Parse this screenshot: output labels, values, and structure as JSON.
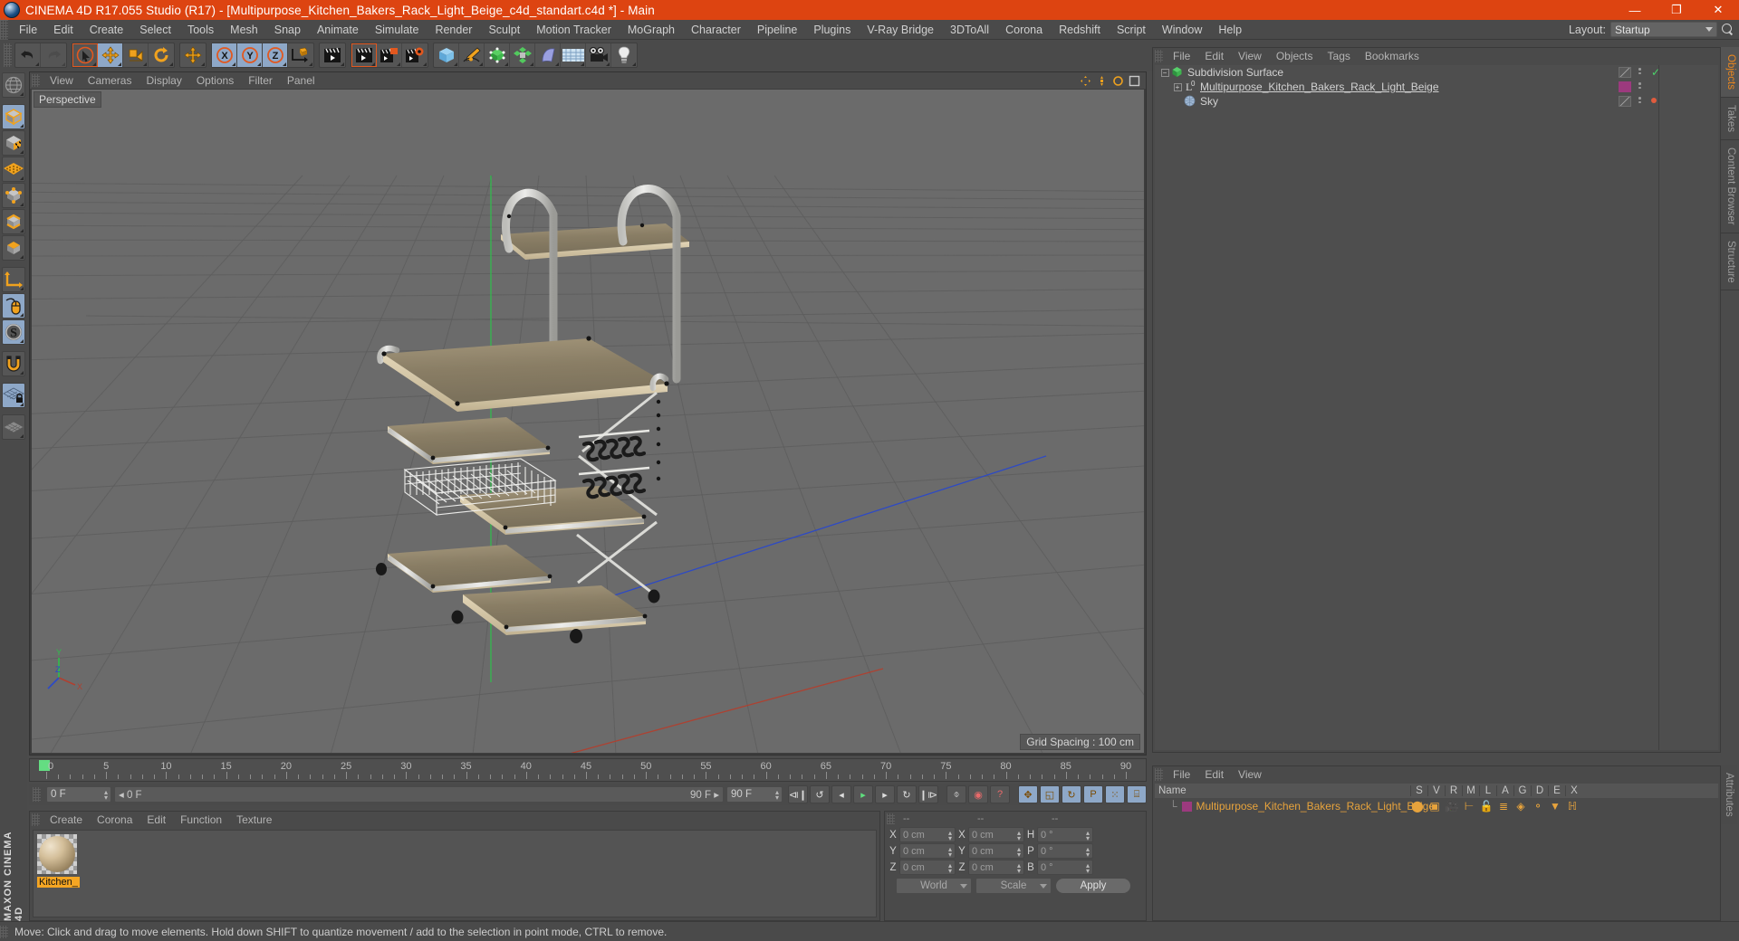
{
  "window": {
    "title": "CINEMA 4D R17.055 Studio (R17) - [Multipurpose_Kitchen_Bakers_Rack_Light_Beige_c4d_standart.c4d *] - Main",
    "minimize": "—",
    "maximize": "❐",
    "close": "✕",
    "accent": "#dd4411"
  },
  "menubar": {
    "items": [
      "File",
      "Edit",
      "Create",
      "Select",
      "Tools",
      "Mesh",
      "Snap",
      "Animate",
      "Simulate",
      "Render",
      "Sculpt",
      "Motion Tracker",
      "MoGraph",
      "Character",
      "Pipeline",
      "Plugins",
      "V-Ray Bridge",
      "3DToAll",
      "Corona",
      "Redshift",
      "Script",
      "Window",
      "Help"
    ],
    "layout_label": "Layout:",
    "layout_value": "Startup"
  },
  "toolbar": {
    "groups": [
      {
        "name": "history",
        "buttons": [
          {
            "name": "undo-button",
            "icon": "undo",
            "state": "off"
          },
          {
            "name": "redo-button",
            "icon": "redo",
            "state": "disabled"
          }
        ]
      },
      {
        "name": "transform-tools",
        "buttons": [
          {
            "name": "select-tool-button",
            "icon": "cursor-select",
            "state": "sel"
          },
          {
            "name": "move-tool-button",
            "icon": "move",
            "state": "on"
          },
          {
            "name": "scale-tool-button",
            "icon": "scale",
            "state": "off"
          },
          {
            "name": "rotate-tool-button",
            "icon": "rotate",
            "state": "off"
          }
        ]
      },
      {
        "name": "modelling-axis",
        "buttons": [
          {
            "name": "move-axis-button",
            "icon": "move",
            "state": "off"
          }
        ]
      },
      {
        "name": "axis-locks",
        "buttons": [
          {
            "name": "lock-x-button",
            "icon": "axis-x",
            "state": "on"
          },
          {
            "name": "lock-y-button",
            "icon": "axis-y",
            "state": "on"
          },
          {
            "name": "lock-z-button",
            "icon": "axis-z",
            "state": "on"
          },
          {
            "name": "world-object-coord-button",
            "icon": "world-axis",
            "state": "off"
          }
        ]
      },
      {
        "name": "render-group-a",
        "buttons": [
          {
            "name": "render-view-button",
            "icon": "clapper",
            "state": "off"
          }
        ]
      },
      {
        "name": "render-group-b",
        "buttons": [
          {
            "name": "render-region-button",
            "icon": "clapper-frame",
            "state": "sel"
          },
          {
            "name": "render-to-picture-viewer-button",
            "icon": "clapper-pv",
            "state": "off"
          },
          {
            "name": "render-settings-button",
            "icon": "clapper-gear",
            "state": "off"
          }
        ]
      },
      {
        "name": "create-objects",
        "buttons": [
          {
            "name": "add-cube-button",
            "icon": "cube-blue",
            "state": "off"
          },
          {
            "name": "add-spline-button",
            "icon": "pen-spline",
            "state": "off"
          },
          {
            "name": "add-generator-button",
            "icon": "cube-green",
            "state": "off"
          },
          {
            "name": "add-array-button",
            "icon": "mograph-cloner",
            "state": "off"
          },
          {
            "name": "add-deformer-button",
            "icon": "bend-deformer",
            "state": "off"
          },
          {
            "name": "add-scene-object-button",
            "icon": "floor-grid",
            "state": "off"
          },
          {
            "name": "add-camera-button",
            "icon": "camera",
            "state": "off"
          },
          {
            "name": "add-light-button",
            "icon": "light-bulb",
            "state": "off"
          }
        ]
      }
    ]
  },
  "lefttools": {
    "items": [
      {
        "name": "undo-view-button",
        "icon": "globe-wire",
        "state": "off"
      },
      {
        "name": "model-mode-button",
        "icon": "cube-model",
        "state": "on"
      },
      {
        "name": "texture-mode-button",
        "icon": "cube-texture",
        "state": "off"
      },
      {
        "name": "polygon-mode-button",
        "icon": "poly-mesh",
        "state": "off"
      },
      {
        "name": "points-mode-button",
        "icon": "cube-points",
        "state": "off"
      },
      {
        "name": "edges-mode-button",
        "icon": "cube-edges",
        "state": "off"
      },
      {
        "name": "polygons-mode-button",
        "icon": "cube-poly",
        "state": "off"
      },
      {
        "name": "object-axis-button",
        "icon": "axis-l",
        "state": "off"
      },
      {
        "name": "viewport-solo-button",
        "icon": "mouse",
        "state": "on"
      },
      {
        "name": "snap-s-button",
        "icon": "letter-s",
        "state": "on"
      },
      {
        "name": "magnet-button",
        "icon": "magnet",
        "state": "off"
      },
      {
        "name": "workplane-lock-button",
        "icon": "grid-lock",
        "state": "on"
      },
      {
        "name": "workplane-button",
        "icon": "grid-plane",
        "state": "off"
      }
    ]
  },
  "brand": {
    "text": "MAXON CINEMA 4D"
  },
  "viewport": {
    "menu": [
      "View",
      "Cameras",
      "Display",
      "Options",
      "Filter",
      "Panel"
    ],
    "label": "Perspective",
    "grid_spacing": "Grid Spacing : 100 cm",
    "background": "#6b6b6b",
    "axis_colors": {
      "x": "#c0392b",
      "y": "#2ecc71",
      "z": "#2b4fd8"
    }
  },
  "timeline": {
    "ticks": [
      {
        "label": "0",
        "frame": 0
      },
      {
        "label": "5",
        "frame": 5
      },
      {
        "label": "10",
        "frame": 10
      },
      {
        "label": "15",
        "frame": 15
      },
      {
        "label": "20",
        "frame": 20
      },
      {
        "label": "25",
        "frame": 25
      },
      {
        "label": "30",
        "frame": 30
      },
      {
        "label": "35",
        "frame": 35
      },
      {
        "label": "40",
        "frame": 40
      },
      {
        "label": "45",
        "frame": 45
      },
      {
        "label": "50",
        "frame": 50
      },
      {
        "label": "55",
        "frame": 55
      },
      {
        "label": "60",
        "frame": 60
      },
      {
        "label": "65",
        "frame": 65
      },
      {
        "label": "70",
        "frame": 70
      },
      {
        "label": "75",
        "frame": 75
      },
      {
        "label": "80",
        "frame": 80
      },
      {
        "label": "85",
        "frame": 85
      },
      {
        "label": "90",
        "frame": 90
      }
    ],
    "current_frame_field": "0 F",
    "range_start": "0 F",
    "range_end": "90 F",
    "max_frame_field": "90 F",
    "preview_end_field": "0 F",
    "transport": [
      {
        "name": "go-to-start-button",
        "glyph": "⧏❙"
      },
      {
        "name": "play-backwards-loop-button",
        "glyph": "↺"
      },
      {
        "name": "step-back-button",
        "glyph": "◂"
      },
      {
        "name": "play-button",
        "glyph": "▸"
      },
      {
        "name": "step-forward-button",
        "glyph": "▸"
      },
      {
        "name": "play-forward-loop-button",
        "glyph": "↻"
      },
      {
        "name": "go-to-end-button",
        "glyph": "❙⧐"
      }
    ],
    "record_buttons": [
      {
        "name": "autokeying-button",
        "glyph": "⌽"
      },
      {
        "name": "record-active-objects-button",
        "glyph": "◉"
      },
      {
        "name": "keyframe-selection-button",
        "glyph": "?"
      }
    ],
    "pos_buttons": [
      {
        "name": "record-position-button",
        "glyph": "✥"
      },
      {
        "name": "record-scale-button",
        "glyph": "◱"
      },
      {
        "name": "record-rotation-button",
        "glyph": "↻"
      },
      {
        "name": "record-parameter-button",
        "glyph": "P"
      },
      {
        "name": "point-level-animation-button",
        "glyph": "⁙"
      },
      {
        "name": "timeline-button",
        "glyph": "⌸"
      }
    ]
  },
  "materials": {
    "menu": [
      "Create",
      "Corona",
      "Edit",
      "Function",
      "Texture"
    ],
    "items": [
      {
        "name": "Kitchen_",
        "selected": true
      }
    ]
  },
  "coordinates": {
    "headers": [
      "--",
      "--",
      "--"
    ],
    "rows": [
      {
        "axis1": "X",
        "val1": "0 cm",
        "axis2": "X",
        "val2": "0 cm",
        "axis3": "H",
        "val3": "0 °"
      },
      {
        "axis1": "Y",
        "val1": "0 cm",
        "axis2": "Y",
        "val2": "0 cm",
        "axis3": "P",
        "val3": "0 °"
      },
      {
        "axis1": "Z",
        "val1": "0 cm",
        "axis2": "Z",
        "val2": "0 cm",
        "axis3": "B",
        "val3": "0 °"
      }
    ],
    "system_select": "World",
    "mode_select": "Scale",
    "apply_button": "Apply"
  },
  "objectmanager": {
    "menu": [
      "File",
      "Edit",
      "View",
      "Objects",
      "Tags",
      "Bookmarks"
    ],
    "rows": [
      {
        "label": "Subdivision Surface",
        "depth": 0,
        "icon": "subdivision-surface-icon",
        "swatch": "diag",
        "dot": "check"
      },
      {
        "label": "Multipurpose_Kitchen_Bakers_Rack_Light_Beige",
        "depth": 1,
        "icon": "null-object-icon",
        "swatch": "#9c3a7e",
        "dot": "none"
      },
      {
        "label": "Sky",
        "depth": 1,
        "icon": "sky-icon",
        "swatch": "diag",
        "dot": "red"
      }
    ]
  },
  "attributes": {
    "menu": [
      "File",
      "Edit",
      "View"
    ],
    "name_header": "Name",
    "columns": [
      "S",
      "V",
      "R",
      "M",
      "L",
      "A",
      "G",
      "D",
      "E",
      "X"
    ],
    "row_label": "Multipurpose_Kitchen_Bakers_Rack_Light_Beige",
    "row_color": "#e7a33c",
    "swatch": "#9c3a7e"
  },
  "righttabs": {
    "top": [
      "Objects",
      "Takes",
      "Content Browser",
      "Structure"
    ],
    "active": "Objects",
    "bottom": [
      "Attributes"
    ]
  },
  "statusbar": {
    "text": "Move: Click and drag to move elements. Hold down SHIFT to quantize movement / add to the selection in point mode, CTRL to remove."
  }
}
